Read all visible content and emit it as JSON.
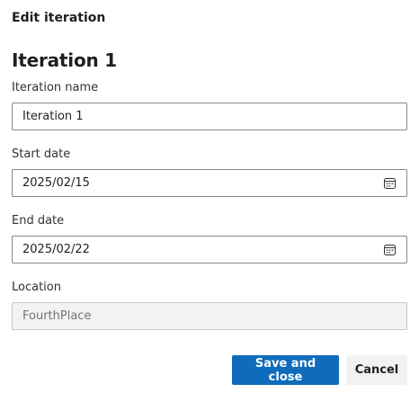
{
  "dialog": {
    "title": "Edit iteration",
    "section_title": "Iteration 1"
  },
  "form": {
    "iteration_name": {
      "label": "Iteration name",
      "value": "Iteration 1"
    },
    "start_date": {
      "label": "Start date",
      "value": "2025/02/15",
      "icon": "calendar-icon"
    },
    "end_date": {
      "label": "End date",
      "value": "2025/02/22",
      "icon": "calendar-icon"
    },
    "location": {
      "label": "Location",
      "placeholder": "FourthPlace",
      "disabled": true
    }
  },
  "actions": {
    "save_label": "Save and close",
    "cancel_label": "Cancel"
  },
  "colors": {
    "primary": "#0f6cbd",
    "border": "#8a8886",
    "disabled_bg": "#f3f2f1"
  }
}
